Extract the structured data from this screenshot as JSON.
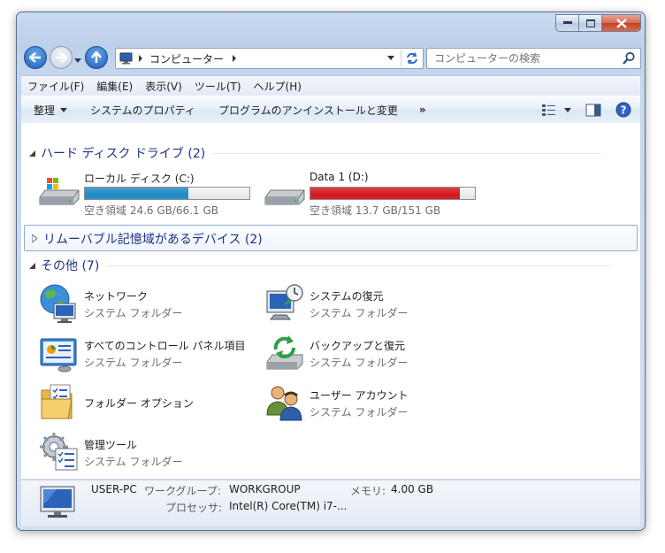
{
  "address": {
    "path_label": "コンピューター"
  },
  "search": {
    "placeholder": "コンピューターの検索"
  },
  "menu": {
    "items": [
      "ファイル(F)",
      "編集(E)",
      "表示(V)",
      "ツール(T)",
      "ヘルプ(H)"
    ]
  },
  "toolbar": {
    "organize": "整理",
    "system_properties": "システムのプロパティ",
    "uninstall": "プログラムのアンインストールと変更",
    "more": "»"
  },
  "groups": {
    "hdd": "ハード ディスク ドライブ (2)",
    "removable": "リムーバブル記憶域があるデバイス (2)",
    "other": "その他 (7)"
  },
  "drives": [
    {
      "name": "ローカル ディスク (C:)",
      "space": "空き領域 24.6 GB/66.1 GB",
      "used_fraction": 0.628,
      "bar_color": "#1f8bc6"
    },
    {
      "name": "Data 1 (D:)",
      "space": "空き領域 13.7 GB/151 GB",
      "used_fraction": 0.909,
      "bar_color": "#d5171c"
    }
  ],
  "other_items": [
    {
      "name": "ネットワーク",
      "type": "システム フォルダー",
      "icon": "network-globe-icon"
    },
    {
      "name": "システムの復元",
      "type": "システム フォルダー",
      "icon": "system-restore-icon"
    },
    {
      "name": "すべてのコントロール パネル項目",
      "type": "システム フォルダー",
      "icon": "control-panel-icon"
    },
    {
      "name": "バックアップと復元",
      "type": "システム フォルダー",
      "icon": "backup-restore-icon"
    },
    {
      "name": "フォルダー オプション",
      "type": "",
      "icon": "folder-options-icon"
    },
    {
      "name": "ユーザー アカウント",
      "type": "システム フォルダー",
      "icon": "user-accounts-icon"
    },
    {
      "name": "管理ツール",
      "type": "システム フォルダー",
      "icon": "admin-tools-icon"
    }
  ],
  "details": {
    "computer_name": "USER-PC",
    "workgroup_label": "ワークグループ:",
    "workgroup_value": "WORKGROUP",
    "memory_label": "メモリ:",
    "memory_value": "4.00 GB",
    "processor_label": "プロセッサ:",
    "processor_value": "Intel(R) Core(TM) i7-..."
  }
}
